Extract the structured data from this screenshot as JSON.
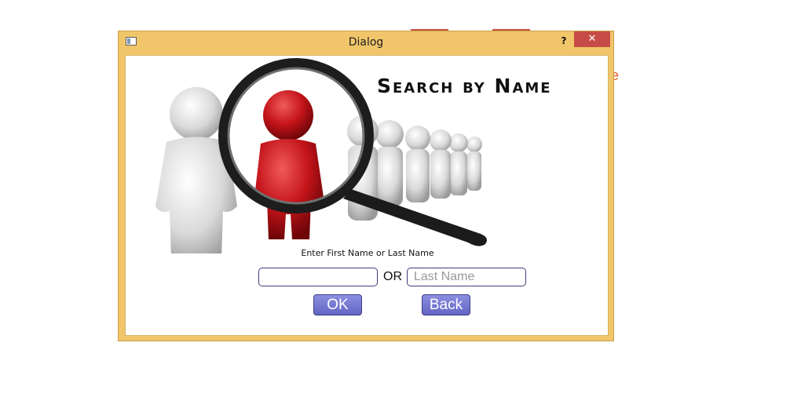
{
  "dialog": {
    "title": "Dialog",
    "help_label": "?",
    "close_label": "✕",
    "heading": "Search by Name",
    "prompt": "Enter First Name or Last Name",
    "first_name": {
      "value": "",
      "placeholder": ""
    },
    "separator": "OR",
    "last_name": {
      "value": "",
      "placeholder": "Last Name"
    },
    "ok_label": "OK",
    "back_label": "Back"
  },
  "colors": {
    "frame": "#f1c66a",
    "close": "#c74b47",
    "button": "#7072cf",
    "figure_red": "#c4141a"
  },
  "icons": [
    "app-window-icon",
    "magnifier-people-illustration"
  ]
}
